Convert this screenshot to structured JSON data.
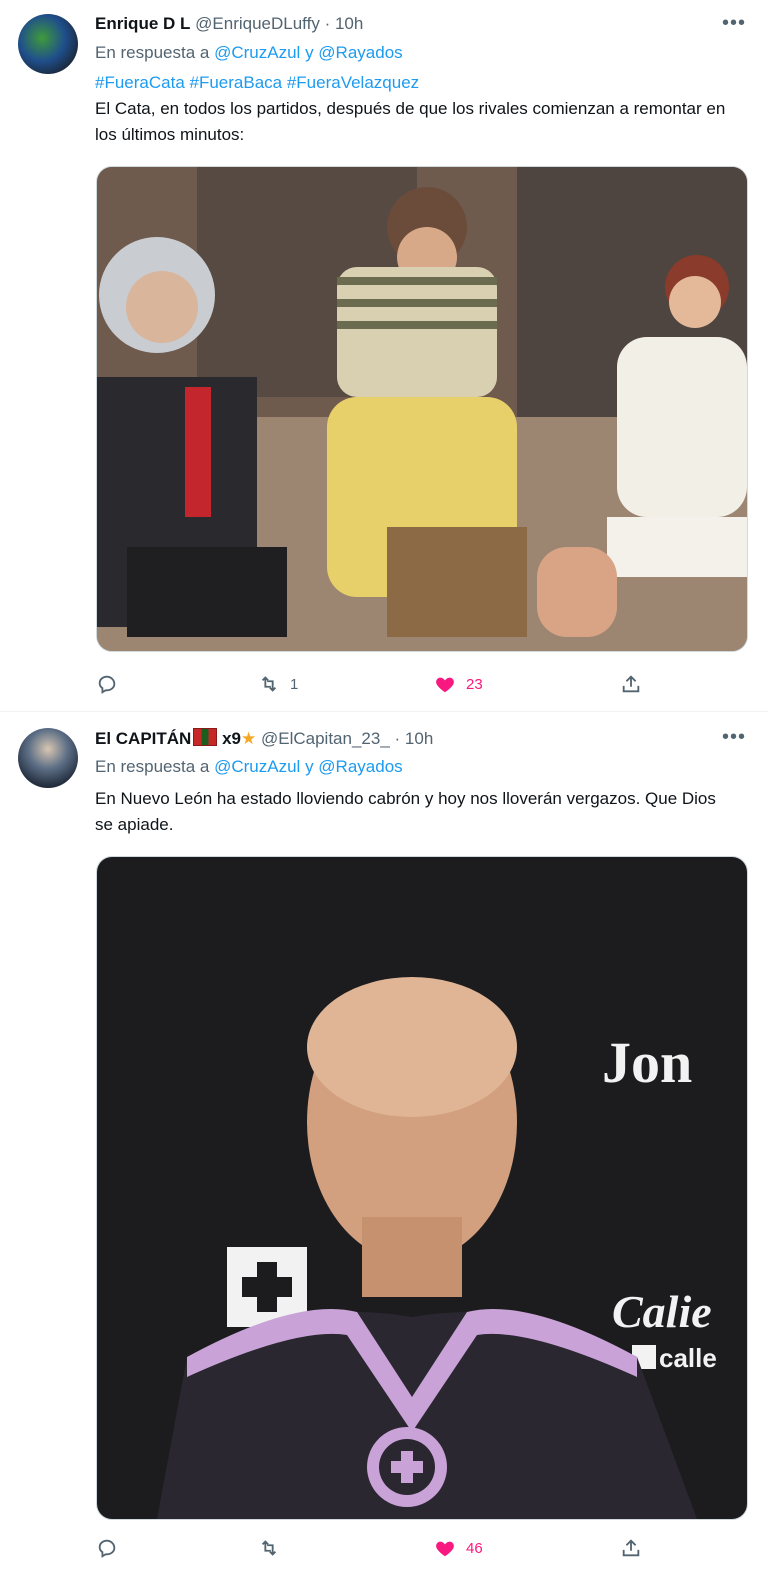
{
  "tweets": [
    {
      "author_name": "Enrique D L",
      "handle": "@EnriqueDLuffy",
      "dot": "·",
      "time": "10h",
      "reply_prefix": "En respuesta a",
      "reply_to_1": "@CruzAzul",
      "reply_joiner": "y",
      "reply_to_2": "@Rayados",
      "hashtags": "#FueraCata #FueraBaca #FueraVelazquez",
      "text": "El Cata, en todos los partidos, después de que los rivales comienzan a remontar en los últimos minutos:",
      "retweets": "1",
      "likes": "23",
      "replies": ""
    },
    {
      "author_name": "El CAPITÁN",
      "author_suffix": "x9",
      "handle": "@ElCapitan_23_",
      "dot": "·",
      "time": "10h",
      "reply_prefix": "En respuesta a",
      "reply_to_1": "@CruzAzul",
      "reply_joiner": "y",
      "reply_to_2": "@Rayados",
      "text": "En Nuevo León ha estado lloviendo cabrón y hoy nos lloverán vergazos. Que Dios se apiade.",
      "media_logo_1": "Jon",
      "media_logo_2": "Calie",
      "media_logo_3": "calle",
      "retweets": "",
      "likes": "46",
      "replies": ""
    }
  ],
  "colors": {
    "accent": "#1d9bf0",
    "like": "#f91880",
    "muted": "#536471"
  },
  "icons": [
    "reply-icon",
    "retweet-icon",
    "heart-icon",
    "share-icon",
    "more-icon",
    "star-icon",
    "flag-icon"
  ]
}
